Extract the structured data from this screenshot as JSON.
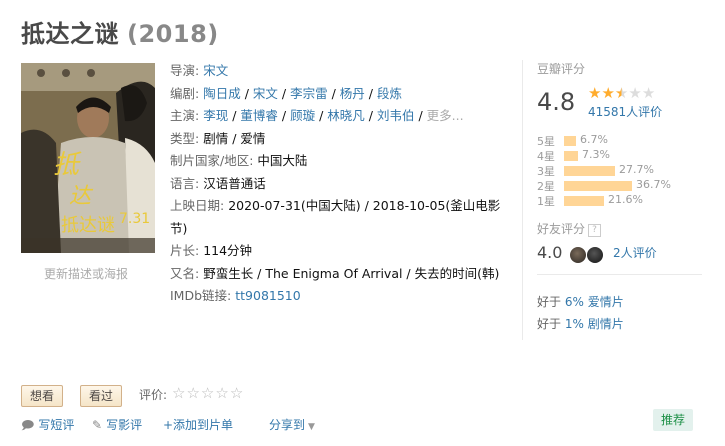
{
  "title": "抵达之谜",
  "year": "(2018)",
  "poster_caption": "更新描述或海报",
  "info": {
    "director_label": "导演:",
    "directors": [
      "宋文"
    ],
    "writer_label": "编剧:",
    "writers": [
      "陶日成",
      "宋文",
      "李宗雷",
      "杨丹",
      "段炼"
    ],
    "cast_label": "主演:",
    "cast": [
      "李现",
      "董博睿",
      "顾璇",
      "林晓凡",
      "刘韦伯"
    ],
    "cast_more": "更多...",
    "genre_label": "类型:",
    "genres": [
      "剧情",
      "爱情"
    ],
    "country_label": "制片国家/地区:",
    "country": "中国大陆",
    "language_label": "语言:",
    "language": "汉语普通话",
    "release_label": "上映日期:",
    "release": "2020-07-31(中国大陆) / 2018-10-05(釜山电影节)",
    "runtime_label": "片长:",
    "runtime": "114分钟",
    "aka_label": "又名:",
    "aka": "野蛮生长 / The Enigma Of Arrival / 失去的时间(韩)",
    "imdb_label": "IMDb链接:",
    "imdb": "tt9081510"
  },
  "rating": {
    "label": "豆瓣评分",
    "score": "4.8",
    "stars": 2.5,
    "votes": "41581人评价",
    "distribution": [
      {
        "label": "5星",
        "pct": "6.7%",
        "value": 6.7
      },
      {
        "label": "4星",
        "pct": "7.3%",
        "value": 7.3
      },
      {
        "label": "3星",
        "pct": "27.7%",
        "value": 27.7
      },
      {
        "label": "2星",
        "pct": "36.7%",
        "value": 36.7
      },
      {
        "label": "1星",
        "pct": "21.6%",
        "value": 21.6
      }
    ]
  },
  "friends": {
    "label": "好友评分",
    "help": "?",
    "score": "4.0",
    "votes": "2人评价"
  },
  "better_than": [
    {
      "prefix": "好于",
      "pct": "6%",
      "genre": "爱情片"
    },
    {
      "prefix": "好于",
      "pct": "1%",
      "genre": "剧情片"
    }
  ],
  "buttons": {
    "want": "想看",
    "seen": "看过",
    "rate_label": "评价:"
  },
  "actions": {
    "short_review": "写短评",
    "review": "写影评",
    "add_list": "+添加到片单",
    "share": "分享到"
  },
  "recommend": "推荐",
  "colors": {
    "link": "#3377aa",
    "star": "#ffac2d",
    "bar": "#ffd596",
    "recommend_text": "#1b8f45"
  }
}
